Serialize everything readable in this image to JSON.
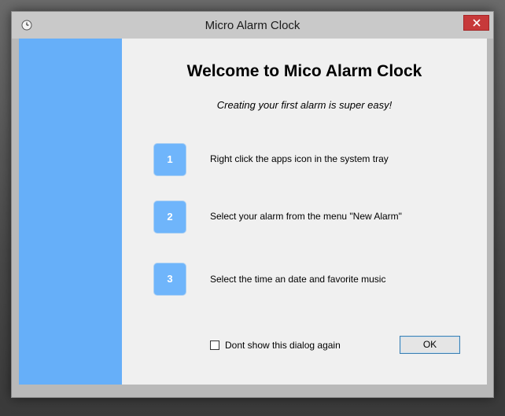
{
  "window": {
    "title": "Micro Alarm Clock"
  },
  "content": {
    "heading": "Welcome to Mico Alarm Clock",
    "subheading": "Creating your first alarm is super easy!",
    "steps": [
      {
        "number": "1",
        "text": "Right click the apps icon in the system tray"
      },
      {
        "number": "2",
        "text": "Select your alarm from the menu \"New Alarm\""
      },
      {
        "number": "3",
        "text": "Select the time an date and favorite music"
      }
    ]
  },
  "footer": {
    "checkbox_label": "Dont show this dialog again",
    "checkbox_checked": false,
    "ok_label": "OK"
  },
  "colors": {
    "side_panel": "#66aff9",
    "step_badge": "#6fb5fb",
    "close_button": "#c7393a"
  },
  "icons": {
    "app": "clock-icon",
    "close": "close-icon"
  }
}
